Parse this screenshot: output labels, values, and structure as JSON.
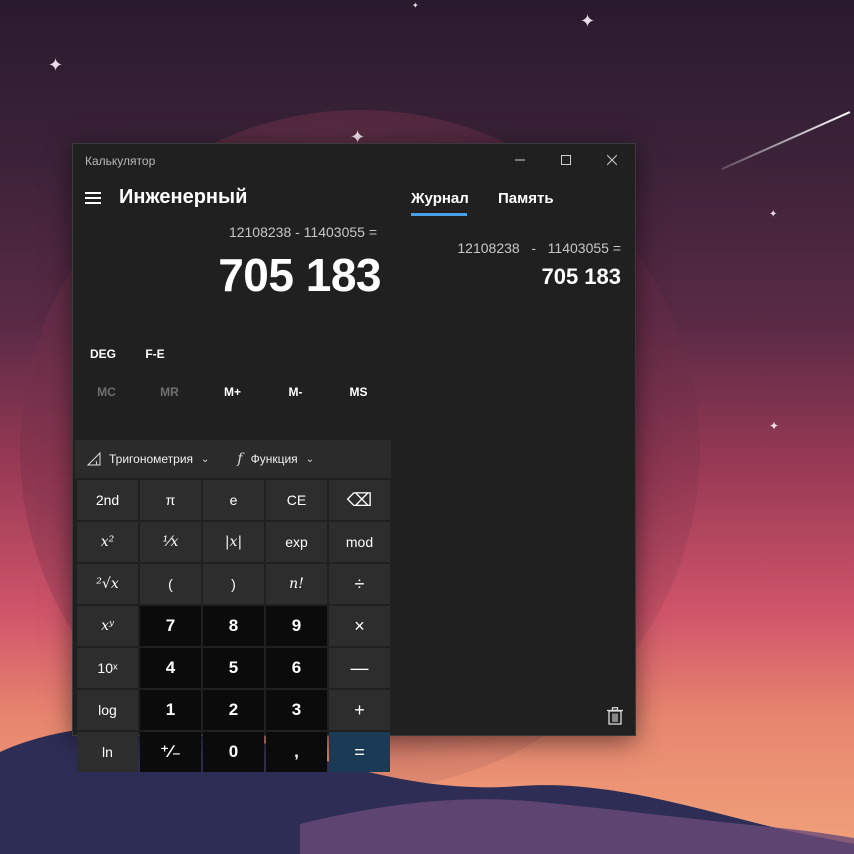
{
  "app": {
    "title": "Калькулятор"
  },
  "window_controls": {
    "minimize": "—",
    "maximize": "☐",
    "close": "✕"
  },
  "header": {
    "mode": "Инженерный"
  },
  "display": {
    "expression": "12108238 - 11403055 =",
    "result": "705 183"
  },
  "modes": [
    "DEG",
    "F-E"
  ],
  "memory": [
    {
      "label": "MC",
      "enabled": false
    },
    {
      "label": "MR",
      "enabled": false
    },
    {
      "label": "M+",
      "enabled": true
    },
    {
      "label": "M-",
      "enabled": true
    },
    {
      "label": "MS",
      "enabled": true
    }
  ],
  "functions": {
    "trig": {
      "label": "Тригонометрия",
      "icon": "triangle-icon"
    },
    "func": {
      "label": "Функция",
      "icon": "function-icon"
    }
  },
  "keys": [
    [
      "2nd",
      "π",
      "e",
      "CE",
      "⌫"
    ],
    [
      "x²",
      "¹⁄x",
      "|x|",
      "exp",
      "mod"
    ],
    [
      "²√x",
      "(",
      ")",
      "n!",
      "÷"
    ],
    [
      "xʸ",
      "7",
      "8",
      "9",
      "×"
    ],
    [
      "10ˣ",
      "4",
      "5",
      "6",
      "—"
    ],
    [
      "log",
      "1",
      "2",
      "3",
      "+"
    ],
    [
      "ln",
      "⁺∕₋",
      "0",
      ",",
      "="
    ]
  ],
  "history_panel": {
    "tabs": [
      "Журнал",
      "Память"
    ],
    "active_tab": "Журнал",
    "entries": [
      {
        "expression": "12108238   -   11403055 =",
        "result": "705 183"
      }
    ],
    "clear_icon": "trash-icon"
  },
  "colors": {
    "accent": "#4aa0e8",
    "equals": "#1b3a55",
    "window_bg": "#202020"
  }
}
